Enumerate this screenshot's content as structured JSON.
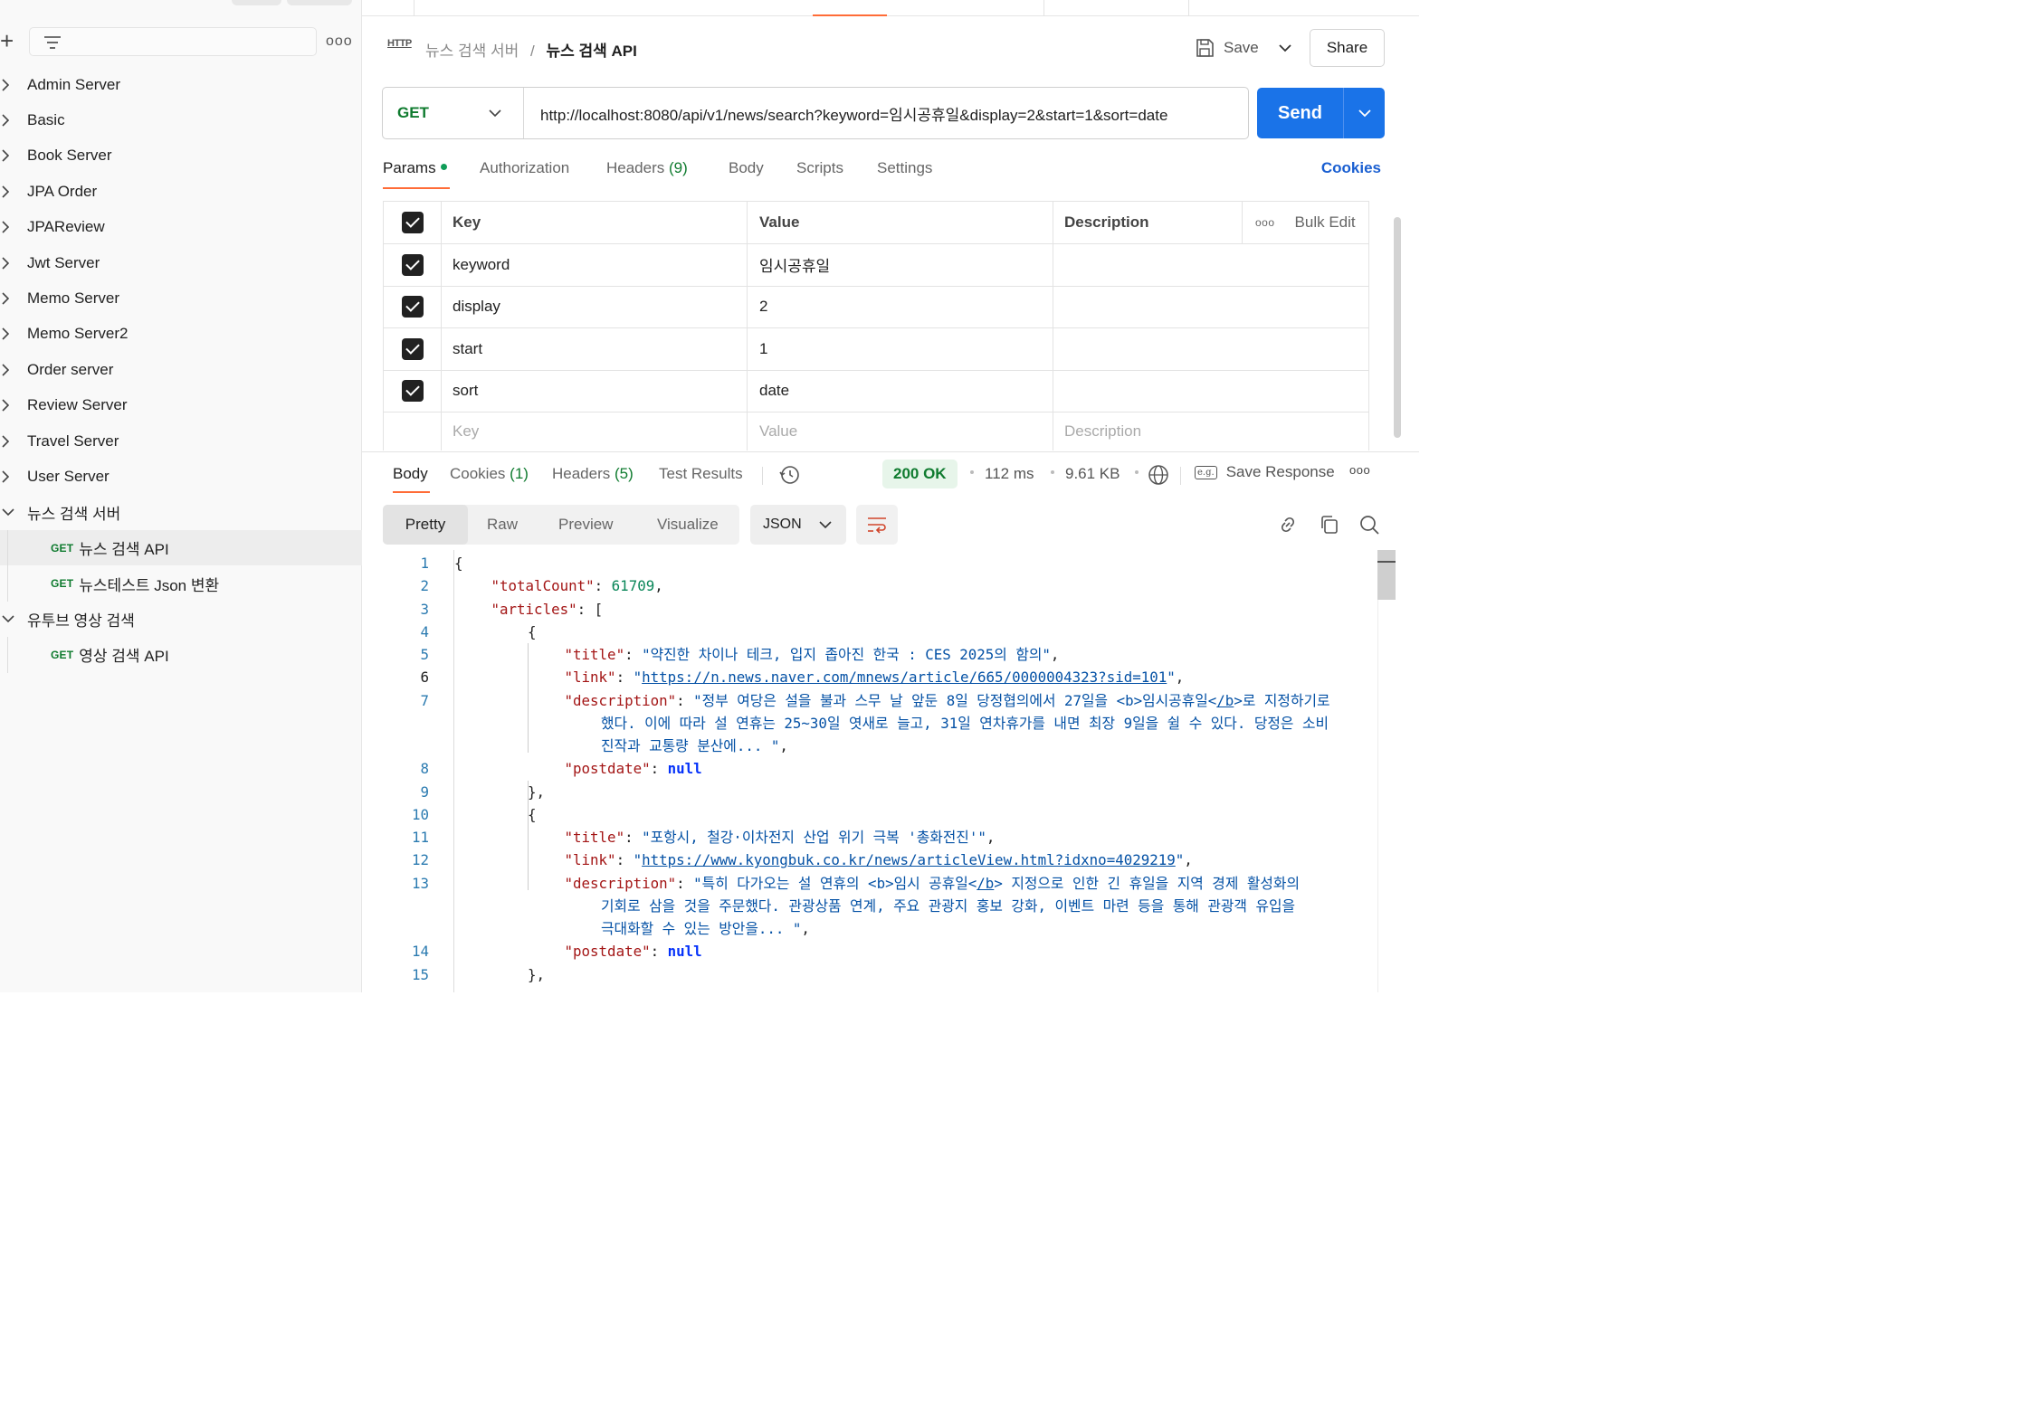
{
  "sidebar": {
    "items": [
      {
        "label": "Admin Server",
        "type": "collection",
        "expanded": false
      },
      {
        "label": "Basic",
        "type": "collection",
        "expanded": false
      },
      {
        "label": "Book Server",
        "type": "collection",
        "expanded": false
      },
      {
        "label": "JPA Order",
        "type": "collection",
        "expanded": false
      },
      {
        "label": "JPAReview",
        "type": "collection",
        "expanded": false
      },
      {
        "label": "Jwt Server",
        "type": "collection",
        "expanded": false
      },
      {
        "label": "Memo Server",
        "type": "collection",
        "expanded": false
      },
      {
        "label": "Memo Server2",
        "type": "collection",
        "expanded": false
      },
      {
        "label": "Order server",
        "type": "collection",
        "expanded": false
      },
      {
        "label": "Review Server",
        "type": "collection",
        "expanded": false
      },
      {
        "label": "Travel Server",
        "type": "collection",
        "expanded": false
      },
      {
        "label": "User Server",
        "type": "collection",
        "expanded": false
      },
      {
        "label": "뉴스 검색 서버",
        "type": "collection",
        "expanded": true
      },
      {
        "label": "뉴스 검색 API",
        "type": "request",
        "method": "GET",
        "selected": true
      },
      {
        "label": "뉴스테스트 Json 변환",
        "type": "request",
        "method": "GET",
        "selected": false
      },
      {
        "label": "유투브 영상 검색",
        "type": "collection",
        "expanded": true
      },
      {
        "label": "영상 검색 API",
        "type": "request",
        "method": "GET",
        "selected": false
      }
    ]
  },
  "request": {
    "breadcrumb_parent": "뉴스 검색 서버",
    "breadcrumb_sep": "/",
    "breadcrumb_current": "뉴스 검색 API",
    "http_icon": "HTTP",
    "save_label": "Save",
    "share_label": "Share",
    "method": "GET",
    "url": "http://localhost:8080/api/v1/news/search?keyword=임시공휴일&display=2&start=1&sort=date",
    "send_label": "Send",
    "tabs": {
      "params": "Params",
      "authorization": "Authorization",
      "headers": "Headers",
      "headers_count": "(9)",
      "body": "Body",
      "scripts": "Scripts",
      "settings": "Settings"
    },
    "cookies_label": "Cookies"
  },
  "params": {
    "columns": {
      "key": "Key",
      "value": "Value",
      "description": "Description"
    },
    "bulk_edit": "Bulk Edit",
    "rows": [
      {
        "key": "keyword",
        "value": "임시공휴일",
        "enabled": true
      },
      {
        "key": "display",
        "value": "2",
        "enabled": true
      },
      {
        "key": "start",
        "value": "1",
        "enabled": true
      },
      {
        "key": "sort",
        "value": "date",
        "enabled": true
      }
    ],
    "placeholder": {
      "key": "Key",
      "value": "Value",
      "description": "Description"
    }
  },
  "response": {
    "tabs": {
      "body": "Body",
      "cookies": "Cookies",
      "cookies_count": "(1)",
      "headers": "Headers",
      "headers_count": "(5)",
      "test_results": "Test Results"
    },
    "status": "200 OK",
    "time": "112 ms",
    "size": "9.61 KB",
    "save_response": "Save Response",
    "eg_label": "e.g.",
    "views": {
      "pretty": "Pretty",
      "raw": "Raw",
      "preview": "Preview",
      "visualize": "Visualize"
    },
    "format": "JSON",
    "colors": {
      "status_green": "#0f7b2f",
      "accent_orange": "#ff6c37",
      "send_blue": "#1a73e8"
    }
  },
  "code": {
    "lines": [
      {
        "n": "1",
        "indent": 0,
        "parts": [
          [
            "p",
            "{"
          ]
        ]
      },
      {
        "n": "2",
        "indent": 1,
        "parts": [
          [
            "k",
            "\"totalCount\""
          ],
          [
            "p",
            ": "
          ],
          [
            "n",
            "61709"
          ],
          [
            "p",
            ","
          ]
        ]
      },
      {
        "n": "3",
        "indent": 1,
        "parts": [
          [
            "k",
            "\"articles\""
          ],
          [
            "p",
            ": ["
          ]
        ]
      },
      {
        "n": "4",
        "indent": 2,
        "parts": [
          [
            "p",
            "{"
          ]
        ]
      },
      {
        "n": "5",
        "indent": 3,
        "parts": [
          [
            "k",
            "\"title\""
          ],
          [
            "p",
            ": "
          ],
          [
            "s",
            "\"약진한 차이나 테크, 입지 좁아진 한국 : CES 2025의 함의\""
          ],
          [
            "p",
            ","
          ]
        ]
      },
      {
        "n": "6",
        "indent": 3,
        "parts": [
          [
            "k",
            "\"link\""
          ],
          [
            "p",
            ": "
          ],
          [
            "s",
            "\""
          ],
          [
            "u",
            "https://n.news.naver.com/mnews/article/665/0000004323?sid=101"
          ],
          [
            "s",
            "\""
          ],
          [
            "p",
            ","
          ]
        ]
      },
      {
        "n": "7",
        "indent": 3,
        "parts": [
          [
            "k",
            "\"description\""
          ],
          [
            "p",
            ": "
          ],
          [
            "s",
            "\"정부 여당은 설을 불과 스무 날 앞둔 8일 당정협의에서 27일을 <b>임시공휴일<"
          ],
          [
            "u",
            "/b"
          ],
          [
            "s",
            ">로 지정하기로"
          ]
        ]
      },
      {
        "n": "",
        "indent": 4,
        "parts": [
          [
            "s",
            "했다. 이에 따라 설 연휴는 25~30일 엿새로 늘고, 31일 연차휴가를 내면 최장 9일을 쉴 수 있다. 당정은 소비"
          ]
        ]
      },
      {
        "n": "",
        "indent": 4,
        "parts": [
          [
            "s",
            "진작과 교통량 분산에... \""
          ],
          [
            "p",
            ","
          ]
        ]
      },
      {
        "n": "8",
        "indent": 3,
        "parts": [
          [
            "k",
            "\"postdate\""
          ],
          [
            "p",
            ": "
          ],
          [
            "kw",
            "null"
          ]
        ]
      },
      {
        "n": "9",
        "indent": 2,
        "parts": [
          [
            "p",
            "},"
          ]
        ]
      },
      {
        "n": "10",
        "indent": 2,
        "parts": [
          [
            "p",
            "{"
          ]
        ]
      },
      {
        "n": "11",
        "indent": 3,
        "parts": [
          [
            "k",
            "\"title\""
          ],
          [
            "p",
            ": "
          ],
          [
            "s",
            "\"포항시, 철강·이차전지 산업 위기 극복 '총화전진'\""
          ],
          [
            "p",
            ","
          ]
        ]
      },
      {
        "n": "12",
        "indent": 3,
        "parts": [
          [
            "k",
            "\"link\""
          ],
          [
            "p",
            ": "
          ],
          [
            "s",
            "\""
          ],
          [
            "u",
            "https://www.kyongbuk.co.kr/news/articleView.html?idxno=4029219"
          ],
          [
            "s",
            "\""
          ],
          [
            "p",
            ","
          ]
        ]
      },
      {
        "n": "13",
        "indent": 3,
        "parts": [
          [
            "k",
            "\"description\""
          ],
          [
            "p",
            ": "
          ],
          [
            "s",
            "\"특히 다가오는 설 연휴의 <b>임시 공휴일<"
          ],
          [
            "u",
            "/b"
          ],
          [
            "s",
            "> 지정으로 인한 긴 휴일을 지역 경제 활성화의"
          ]
        ]
      },
      {
        "n": "",
        "indent": 4,
        "parts": [
          [
            "s",
            "기회로 삼을 것을 주문했다. 관광상품 연계, 주요 관광지 홍보 강화, 이벤트 마련 등을 통해 관광객 유입을"
          ]
        ]
      },
      {
        "n": "",
        "indent": 4,
        "parts": [
          [
            "s",
            "극대화할 수 있는 방안을... \""
          ],
          [
            "p",
            ","
          ]
        ]
      },
      {
        "n": "14",
        "indent": 3,
        "parts": [
          [
            "k",
            "\"postdate\""
          ],
          [
            "p",
            ": "
          ],
          [
            "kw",
            "null"
          ]
        ]
      },
      {
        "n": "15",
        "indent": 2,
        "parts": [
          [
            "p",
            "},"
          ]
        ]
      }
    ]
  }
}
